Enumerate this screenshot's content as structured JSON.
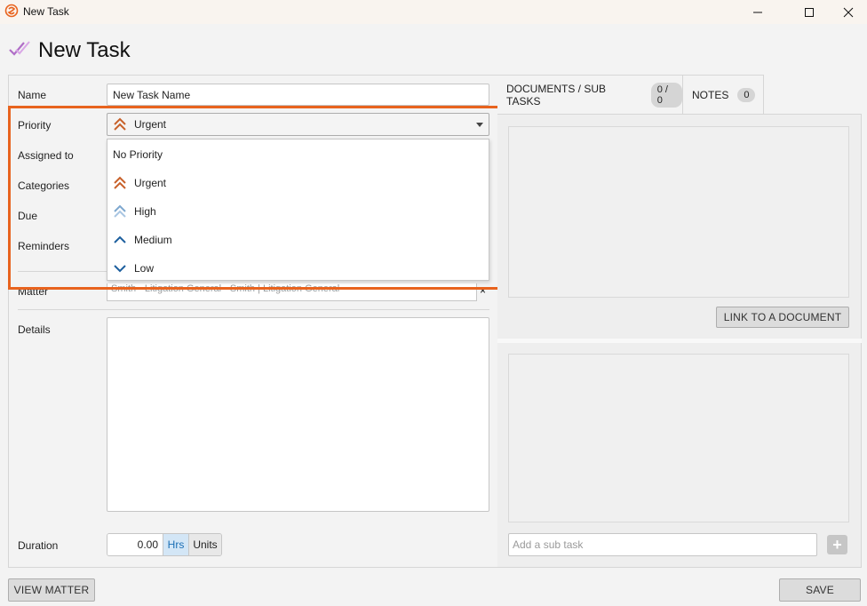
{
  "window": {
    "title": "New Task",
    "icons": {
      "app": "app-logo-icon",
      "minimize": "minimize-icon",
      "maximize": "maximize-icon",
      "close": "close-icon"
    }
  },
  "header": {
    "title": "New Task",
    "icon": "task-check-icon"
  },
  "form": {
    "name_label": "Name",
    "name_value": "New Task Name",
    "priority_label": "Priority",
    "priority_selected": "Urgent",
    "assigned_label": "Assigned to",
    "categories_label": "Categories",
    "due_label": "Due",
    "reminders_label": "Reminders",
    "matter_label": "Matter",
    "matter_value": "Smith - Litigation General - Smith | Litigation General",
    "matter_clear": "×",
    "details_label": "Details",
    "duration_label": "Duration",
    "duration_value": "0.00",
    "unit_hrs": "Hrs",
    "unit_units": "Units"
  },
  "priority_options": [
    {
      "label": "No Priority",
      "icon": ""
    },
    {
      "label": "Urgent",
      "icon": "double-chevron-up-icon"
    },
    {
      "label": "High",
      "icon": "double-chevron-up-light-icon"
    },
    {
      "label": "Medium",
      "icon": "chevron-up-icon"
    },
    {
      "label": "Low",
      "icon": "chevron-down-icon"
    }
  ],
  "tabs": {
    "docs_label": "DOCUMENTS / SUB TASKS",
    "docs_badge": "0 / 0",
    "notes_label": "NOTES",
    "notes_badge": "0"
  },
  "right": {
    "link_doc_button": "LINK TO A DOCUMENT",
    "subtask_placeholder": "Add a sub task",
    "add_button": "+"
  },
  "footer": {
    "view_matter": "VIEW MATTER",
    "save": "SAVE"
  },
  "colors": {
    "highlight": "#e8631e",
    "urgent": "#c8612a",
    "high": "#7ea8cf",
    "medium_low": "#1d5f9e",
    "hrs_active": "#d3e6f6"
  }
}
